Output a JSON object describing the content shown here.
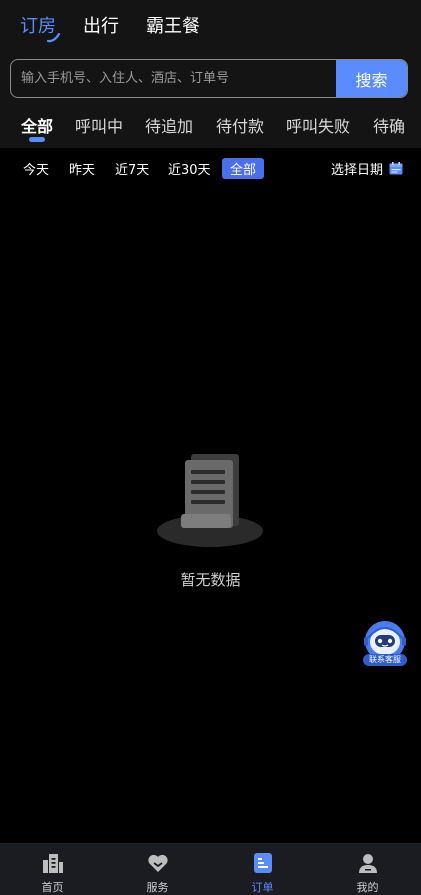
{
  "top_tabs": [
    {
      "label": "订房",
      "active": true
    },
    {
      "label": "出行",
      "active": false
    },
    {
      "label": "霸王餐",
      "active": false
    }
  ],
  "search": {
    "placeholder": "输入手机号、入住人、酒店、订单号",
    "value": "",
    "button_label": "搜索"
  },
  "status_tabs": [
    {
      "label": "全部",
      "active": true
    },
    {
      "label": "呼叫中",
      "active": false
    },
    {
      "label": "待追加",
      "active": false
    },
    {
      "label": "待付款",
      "active": false
    },
    {
      "label": "呼叫失败",
      "active": false
    },
    {
      "label": "待确",
      "active": false
    }
  ],
  "date_filters": [
    {
      "label": "今天",
      "active": false
    },
    {
      "label": "昨天",
      "active": false
    },
    {
      "label": "近7天",
      "active": false
    },
    {
      "label": "近30天",
      "active": false
    },
    {
      "label": "全部",
      "active": true
    }
  ],
  "pick_date_label": "选择日期",
  "empty_text": "暂无数据",
  "customer_service_label": "联系客服",
  "bottom_nav": [
    {
      "label": "首页",
      "icon": "building-icon",
      "active": false
    },
    {
      "label": "服务",
      "icon": "heart-icon",
      "active": false
    },
    {
      "label": "订单",
      "icon": "order-icon",
      "active": true
    },
    {
      "label": "我的",
      "icon": "user-icon",
      "active": false
    }
  ],
  "colors": {
    "accent": "#5b8cff",
    "background": "#000000",
    "header_bg": "#141414",
    "nav_bg": "#1b1b22"
  }
}
